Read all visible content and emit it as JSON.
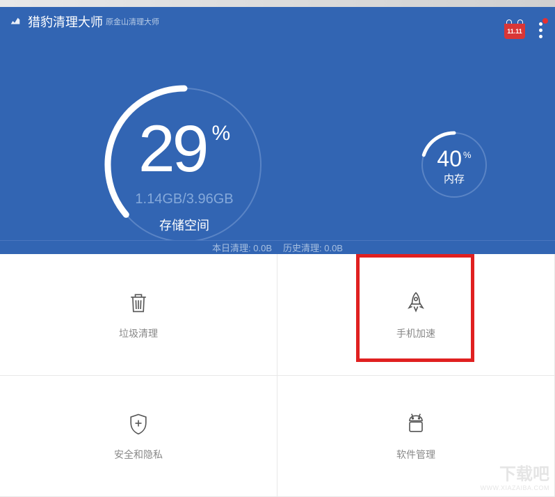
{
  "header": {
    "title": "猎豹清理大师",
    "subtitle": "原金山清理大师",
    "shop_badge": "11.11"
  },
  "storage": {
    "percent": "29",
    "percent_symbol": "%",
    "used": "1.14GB",
    "total": "3.96GB",
    "label": "存储空间"
  },
  "memory": {
    "percent": "40",
    "percent_symbol": "%",
    "label": "内存"
  },
  "stats": {
    "today": "本日清理: 0.0B",
    "history": "历史清理: 0.0B"
  },
  "grid": {
    "trash": "垃圾清理",
    "boost": "手机加速",
    "security": "安全和隐私",
    "apps": "软件管理"
  },
  "watermark": {
    "main": "下载吧",
    "url": "WWW.XIAZAIBA.COM"
  }
}
